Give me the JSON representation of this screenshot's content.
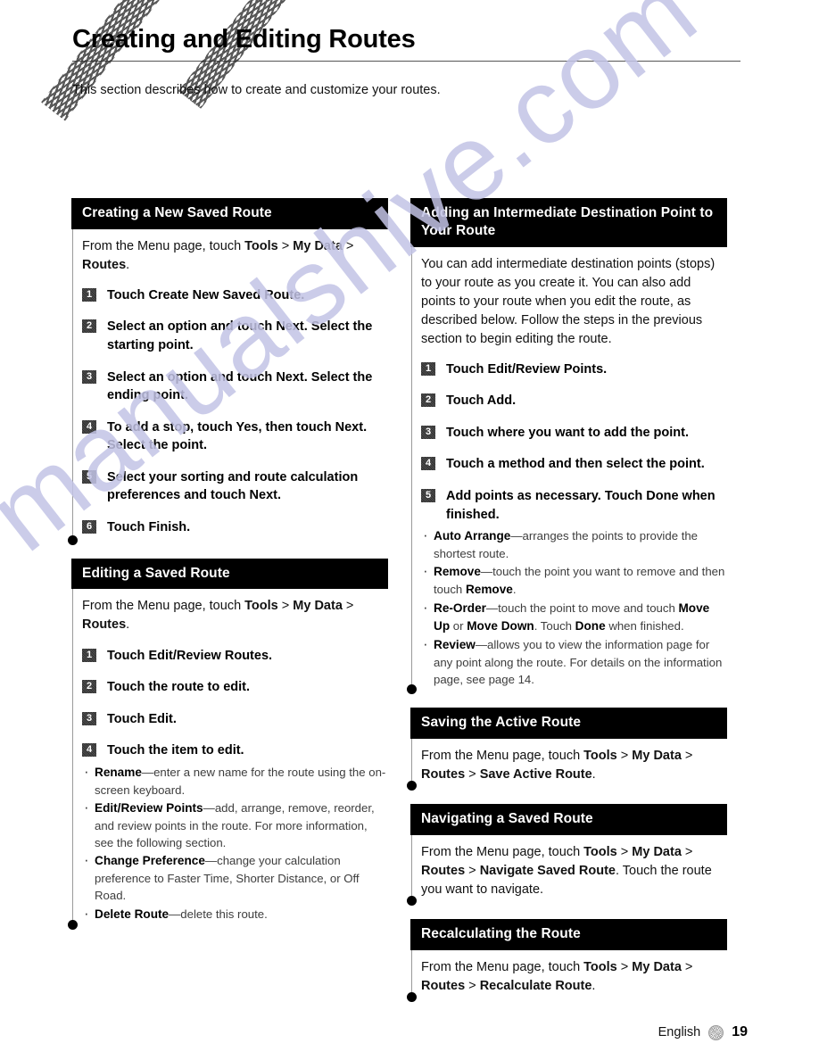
{
  "page": {
    "title": "Creating and Editing Routes",
    "intro": "This section describes how to create and customize your routes.",
    "watermark": "manualshive.com",
    "footer": {
      "language": "English",
      "ornament_icon": "flower-ornament-icon",
      "page_number": "19"
    }
  },
  "left_column": {
    "sections": [
      {
        "heading": "Creating a New Saved Route",
        "intro_html": "From the Menu page, touch <b>Tools</b> &gt; <b>My Data</b> &gt; <b>Routes</b>.",
        "steps": [
          {
            "num": "1",
            "text": "Touch Create New Saved Route."
          },
          {
            "num": "2",
            "text": "Select an option and touch Next. Select the starting point."
          },
          {
            "num": "3",
            "text": "Select an option and touch Next. Select the ending point."
          },
          {
            "num": "4",
            "text": "To add a stop, touch Yes, then touch Next. Select the point."
          },
          {
            "num": "5",
            "text": "Select your sorting and route calculation preferences and touch Next."
          },
          {
            "num": "6",
            "text": "Touch Finish."
          }
        ],
        "bullets": []
      },
      {
        "heading": "Editing a Saved Route",
        "intro_html": "From the Menu page, touch <b>Tools</b> &gt; <b>My Data</b> &gt; <b>Routes</b>.",
        "steps": [
          {
            "num": "1",
            "text": "Touch Edit/Review Routes."
          },
          {
            "num": "2",
            "text": "Touch the route to edit."
          },
          {
            "num": "3",
            "text": "Touch Edit."
          },
          {
            "num": "4",
            "text": "Touch the item to edit."
          }
        ],
        "bullets": [
          {
            "html": "<b>Rename</b>—enter a new name for the route using the on-screen keyboard."
          },
          {
            "html": "<b>Edit/Review Points</b>—add, arrange, remove, reorder, and review points in the route. For more information, see the following section."
          },
          {
            "html": "<b>Change Preference</b>—change your calculation preference to Faster Time, Shorter Distance, or Off Road."
          },
          {
            "html": "<b>Delete Route</b>—delete this route."
          }
        ]
      }
    ]
  },
  "right_column": {
    "sections": [
      {
        "heading": "Adding an Intermediate Destination Point to Your Route",
        "intro_html": "You can add intermediate destination points (stops) to your route as you create it. You can also add points to your route when you edit the route, as described below. Follow the steps in the previous section to begin editing the route.",
        "steps": [
          {
            "num": "1",
            "text": "Touch Edit/Review Points."
          },
          {
            "num": "2",
            "text": "Touch Add."
          },
          {
            "num": "3",
            "text": "Touch where you want to add the point."
          },
          {
            "num": "4",
            "text": "Touch a method and then select the point."
          },
          {
            "num": "5",
            "text": "Add points as necessary. Touch Done when finished."
          }
        ],
        "bullets": [
          {
            "html": "<b>Auto Arrange</b>—arranges the points to provide the shortest route."
          },
          {
            "html": "<b>Remove</b>—touch the point you want to remove and then touch <b>Remove</b>."
          },
          {
            "html": "<b>Re-Order</b>—touch the point to move and touch <b>Move Up</b> or <b>Move Down</b>. Touch <b>Done</b> when finished."
          },
          {
            "html": "<b>Review</b>—allows you to view the information page for any point along the route. For details on the information page, see page 14."
          }
        ]
      },
      {
        "heading": "Saving the Active Route",
        "intro_html": "From the Menu page, touch <b>Tools</b> &gt; <b>My Data</b> &gt; <b>Routes</b> &gt; <b>Save Active Route</b>.",
        "steps": [],
        "bullets": []
      },
      {
        "heading": "Navigating a Saved Route",
        "intro_html": "From the Menu page, touch <b>Tools</b> &gt; <b>My Data</b> &gt; <b>Routes</b> &gt; <b>Navigate Saved Route</b>. Touch the route you want to navigate.",
        "steps": [],
        "bullets": []
      },
      {
        "heading": "Recalculating the Route",
        "intro_html": "From the Menu page, touch <b>Tools</b> &gt; <b>My Data</b> &gt; <b>Routes</b> &gt; <b>Recalculate Route</b>.",
        "steps": [],
        "bullets": []
      }
    ]
  }
}
